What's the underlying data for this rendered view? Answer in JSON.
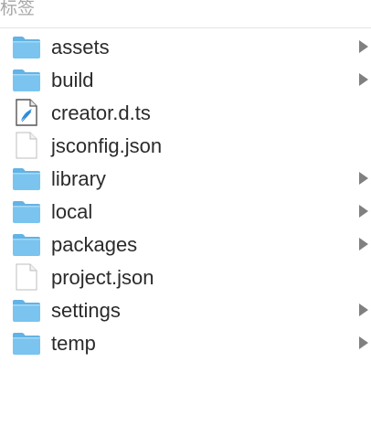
{
  "header": {
    "label": "标签"
  },
  "colors": {
    "folder": "#7ac4ef",
    "folder_tab": "#62b3e6",
    "text": "#2b2b2b",
    "chevron": "#808080",
    "header_text": "#a7a7a7"
  },
  "items": [
    {
      "label": "assets",
      "kind": "folder",
      "icon": "folder-icon",
      "expandable": true
    },
    {
      "label": "build",
      "kind": "folder",
      "icon": "folder-icon",
      "expandable": true
    },
    {
      "label": "creator.d.ts",
      "kind": "file-ts",
      "icon": "ts-file-icon",
      "expandable": false
    },
    {
      "label": "jsconfig.json",
      "kind": "file",
      "icon": "document-icon",
      "expandable": false
    },
    {
      "label": "library",
      "kind": "folder",
      "icon": "folder-icon",
      "expandable": true
    },
    {
      "label": "local",
      "kind": "folder",
      "icon": "folder-icon",
      "expandable": true
    },
    {
      "label": "packages",
      "kind": "folder",
      "icon": "folder-icon",
      "expandable": true
    },
    {
      "label": "project.json",
      "kind": "file",
      "icon": "document-icon",
      "expandable": false
    },
    {
      "label": "settings",
      "kind": "folder",
      "icon": "folder-icon",
      "expandable": true
    },
    {
      "label": "temp",
      "kind": "folder",
      "icon": "folder-icon",
      "expandable": true
    }
  ]
}
